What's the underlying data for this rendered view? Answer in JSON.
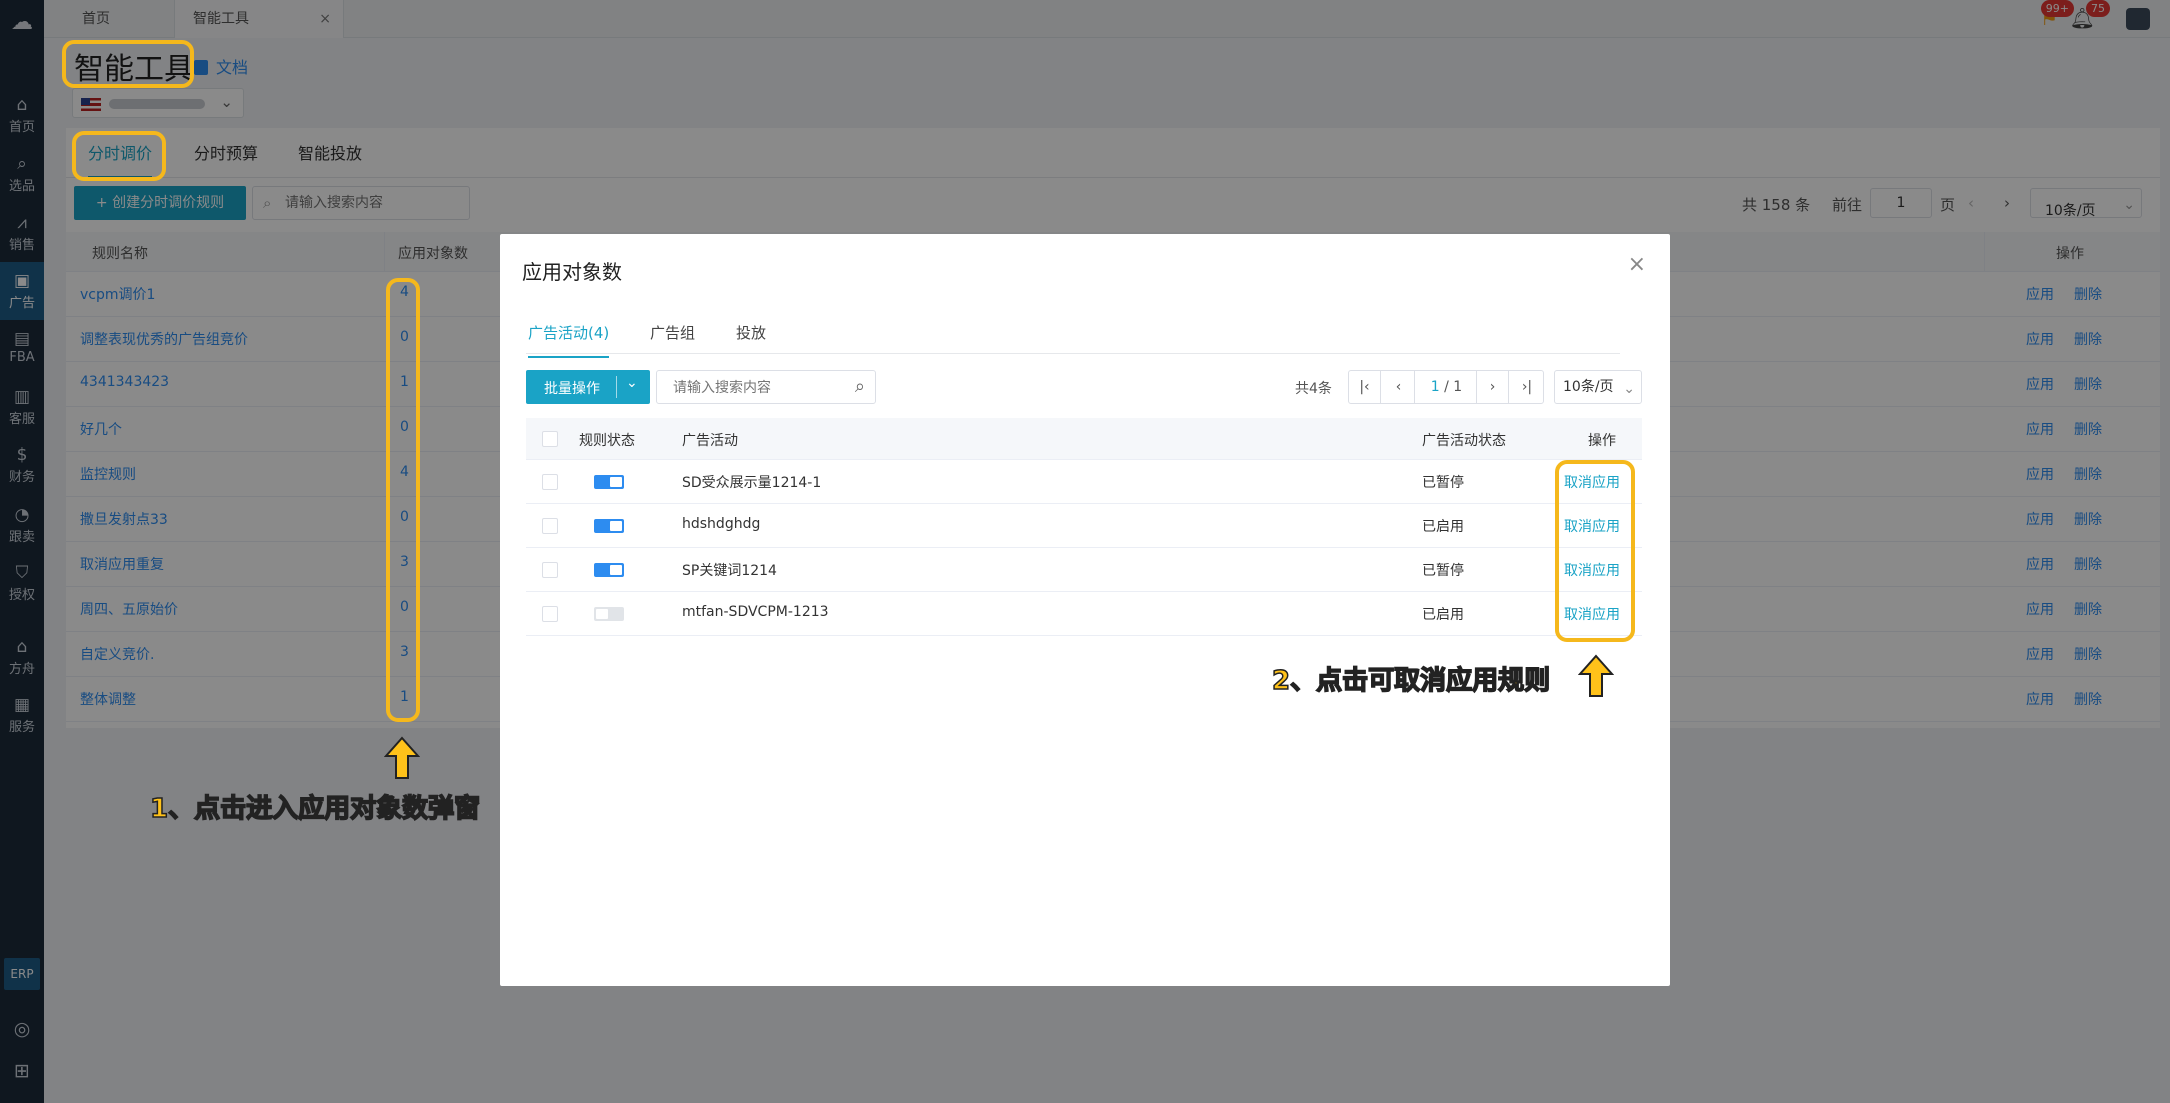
{
  "topbar": {
    "tabs": [
      {
        "label": "首页"
      },
      {
        "label": "智能工具",
        "close": "×"
      }
    ],
    "badges": {
      "flag": "99+",
      "bell": "75"
    }
  },
  "sidebar": {
    "items": [
      {
        "label": "首页",
        "icon": "home-icon",
        "glyph": "⌂"
      },
      {
        "label": "选品",
        "icon": "search-icon",
        "glyph": "⌕"
      },
      {
        "label": "销售",
        "icon": "chart-icon",
        "glyph": "⩘"
      },
      {
        "label": "广告",
        "icon": "ad-icon",
        "glyph": "▣"
      },
      {
        "label": "FBA",
        "icon": "fba-icon",
        "glyph": "▤"
      },
      {
        "label": "客服",
        "icon": "service-icon",
        "glyph": "▥"
      },
      {
        "label": "财务",
        "icon": "finance-icon",
        "glyph": "$"
      },
      {
        "label": "跟卖",
        "icon": "pie-icon",
        "glyph": "◔"
      },
      {
        "label": "授权",
        "icon": "shield-icon",
        "glyph": "⛉"
      },
      {
        "label": "方舟",
        "icon": "ark-icon",
        "glyph": "⌂"
      },
      {
        "label": "服务",
        "icon": "building-icon",
        "glyph": "▦"
      }
    ],
    "erp": "ERP"
  },
  "page": {
    "title": "智能工具",
    "doc_link": "文档"
  },
  "main": {
    "tabs": [
      "分时调价",
      "分时预算",
      "智能投放"
    ],
    "create_button": "+ 创建分时调价规则",
    "search_placeholder": "请输入搜索内容",
    "pager": {
      "total": "共 158 条",
      "goto": "前往",
      "page": "1",
      "page_unit": "页",
      "size": "10条/页"
    },
    "columns": [
      "规则名称",
      "应用对象数",
      "操作"
    ],
    "rows": [
      {
        "name": "vcpm调价1",
        "count": "4"
      },
      {
        "name": "调整表现优秀的广告组竞价",
        "count": "0"
      },
      {
        "name": "4341343423",
        "count": "1"
      },
      {
        "name": "好几个",
        "count": "0"
      },
      {
        "name": "监控规则",
        "count": "4"
      },
      {
        "name": "撒旦发射点33",
        "count": "0"
      },
      {
        "name": "取消应用重复",
        "count": "3"
      },
      {
        "name": "周四、五原始价",
        "count": "0"
      },
      {
        "name": "自定义竞价.",
        "count": "3"
      },
      {
        "name": "整体调整",
        "count": "1"
      }
    ],
    "row_actions": {
      "apply": "应用",
      "delete": "删除"
    }
  },
  "modal": {
    "title": "应用对象数",
    "close": "×",
    "tabs": [
      "广告活动(4)",
      "广告组",
      "投放"
    ],
    "batch_button": "批量操作",
    "search_placeholder": "请输入搜索内容",
    "total": "共4条",
    "pager": {
      "current": "1",
      "of": "/ 1"
    },
    "page_size": "10条/页",
    "columns": [
      "规则状态",
      "广告活动",
      "广告活动状态",
      "操作"
    ],
    "rows": [
      {
        "campaign": "SD受众展示量1214-1",
        "status": "已暂停",
        "enabled": true,
        "action": "取消应用"
      },
      {
        "campaign": "hdshdghdg",
        "status": "已启用",
        "enabled": true,
        "action": "取消应用"
      },
      {
        "campaign": "SP关键词1214",
        "status": "已暂停",
        "enabled": true,
        "action": "取消应用"
      },
      {
        "campaign": "mtfan-SDVCPM-1213",
        "status": "已启用",
        "enabled": false,
        "action": "取消应用"
      }
    ]
  },
  "annotations": {
    "step1": "1、点击进入应用对象数弹窗",
    "step2": "2、点击可取消应用规则",
    "color": "#f5b81c"
  }
}
